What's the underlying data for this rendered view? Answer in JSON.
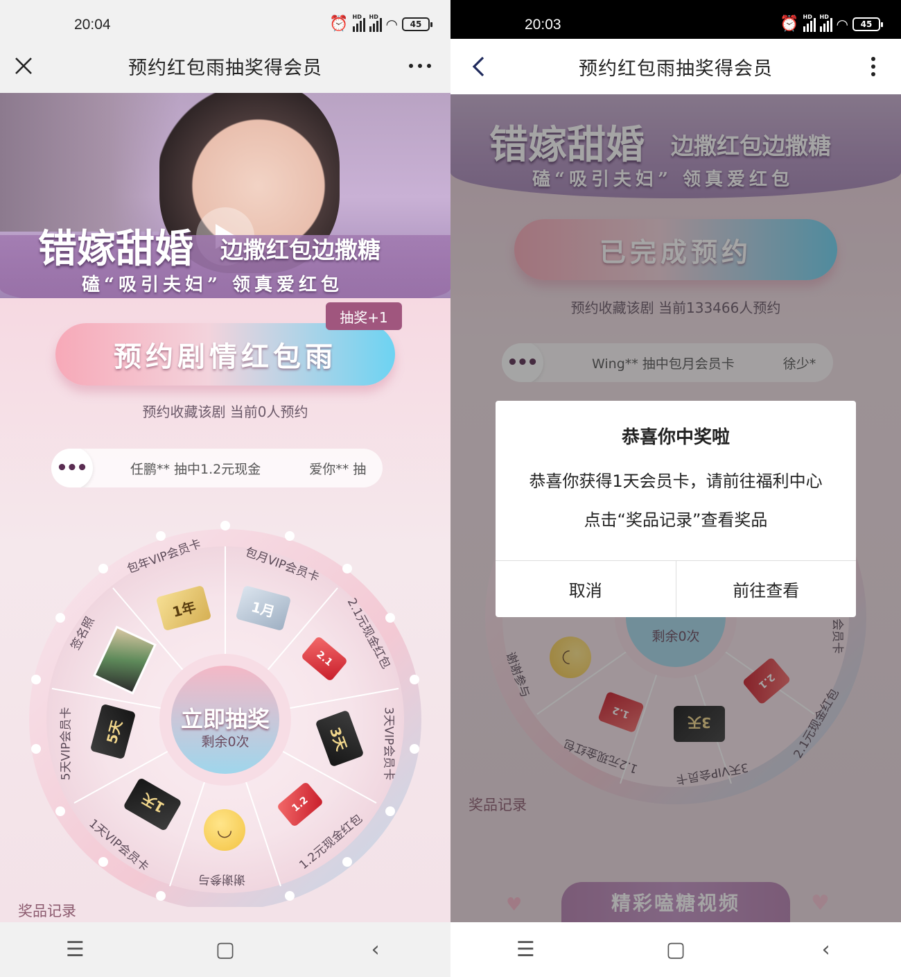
{
  "left": {
    "status": {
      "time": "20:04",
      "battery": "45"
    },
    "title": "预约红包雨抽奖得会员",
    "banner": {
      "title_big": "错嫁甜婚",
      "title_side": "边撒红包边撒糖",
      "subtitle": "磕“吸引夫妇” 领真爱红包"
    },
    "badge": "抽奖+1",
    "main_button": "预约剧情红包雨",
    "reserve_text": "预约收藏该剧 当前0人预约",
    "ticker": {
      "dots": "•••",
      "msg1": "任鹏** 抽中1.2元现金",
      "msg2": "爱你** 抽"
    },
    "wheel": {
      "center_title": "立即抽奖",
      "center_sub": "剩余0次",
      "prizes": [
        "包年VIP会员卡",
        "包月VIP会员卡",
        "2.1元现金红包",
        "3天VIP会员卡",
        "1.2元现金红包",
        "谢谢参与",
        "1天VIP会员卡",
        "5天VIP会员卡",
        "签名照"
      ],
      "cards": [
        "1年",
        "1月",
        "2.1",
        "3天",
        "1.2",
        "1天",
        "5天"
      ]
    },
    "records": "奖品记录"
  },
  "right": {
    "status": {
      "time": "20:03",
      "battery": "45"
    },
    "title": "预约红包雨抽奖得会员",
    "banner": {
      "title_big": "错嫁甜婚",
      "title_side": "边撒红包边撒糖",
      "subtitle": "磕“吸引夫妇” 领真爱红包"
    },
    "main_button": "已完成预约",
    "reserve_text": "预约收藏该剧 当前133466人预约",
    "ticker": {
      "dots": "•••",
      "msg1": "Wing** 抽中包月会员卡",
      "msg2": "徐少*"
    },
    "wheel": {
      "center_sub": "剩余0次",
      "prizes": [
        "谢谢参与",
        "1.2元现金红包",
        "3天VIP会员卡",
        "2.1元现金红包",
        "会员卡"
      ],
      "cards": [
        "1.2",
        "3天",
        "2.1"
      ]
    },
    "records": "奖品记录",
    "bottom_banner": "精彩嗑糖视频",
    "dialog": {
      "title": "恭喜你中奖啦",
      "message": "恭喜你获得1天会员卡，请前往福利中心点击“奖品记录”查看奖品",
      "cancel": "取消",
      "confirm": "前往查看"
    }
  },
  "navbar": {
    "menu": "☰",
    "home": "▢",
    "back": "‹"
  },
  "colors": {
    "accent_pink": "#f7a9b8",
    "accent_blue": "#6dd3f2",
    "banner_purple": "#9b7ea6"
  }
}
